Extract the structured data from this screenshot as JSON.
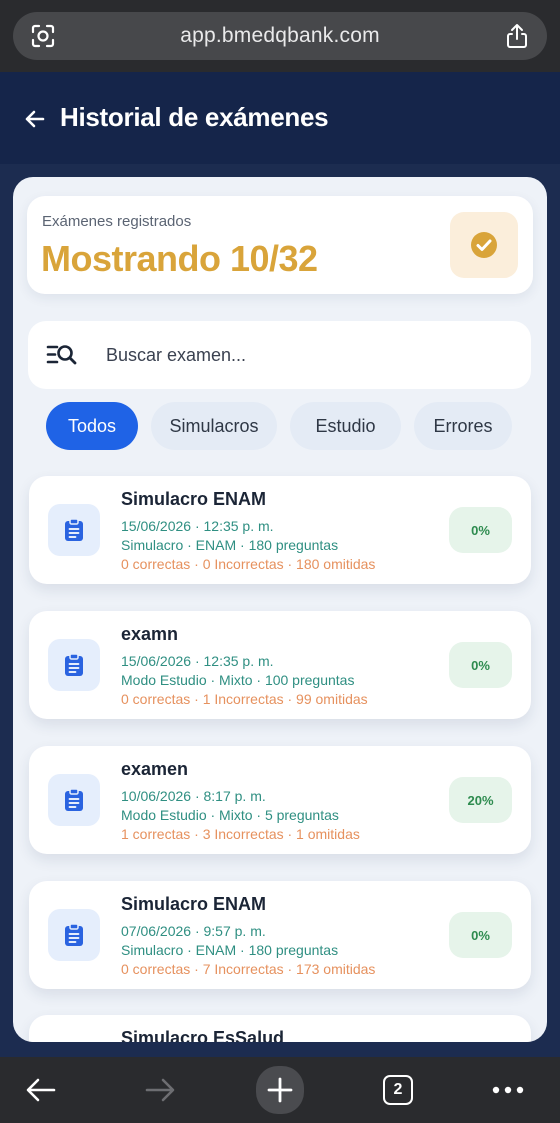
{
  "browser": {
    "url": "app.bmedqbank.com",
    "tab_count": "2"
  },
  "header": {
    "title": "Historial de exámenes"
  },
  "summary": {
    "label": "Exámenes registrados",
    "value": "Mostrando 10/32"
  },
  "search": {
    "placeholder": "Buscar examen..."
  },
  "filters": [
    {
      "label": "Todos",
      "active": true
    },
    {
      "label": "Simulacros",
      "active": false
    },
    {
      "label": "Estudio",
      "active": false
    },
    {
      "label": "Errores",
      "active": false
    }
  ],
  "exams": [
    {
      "title": "Simulacro ENAM",
      "date": "15/06/2026 · 12:35 p. m.",
      "meta": "Simulacro · ENAM · 180 preguntas",
      "stats": "0 correctas · 0 Incorrectas · 180 omitidas",
      "score": "0%"
    },
    {
      "title": "examn",
      "date": "15/06/2026 · 12:35 p. m.",
      "meta": "Modo Estudio · Mixto · 100 preguntas",
      "stats": "0 correctas · 1 Incorrectas · 99 omitidas",
      "score": "0%"
    },
    {
      "title": "examen",
      "date": "10/06/2026 · 8:17 p. m.",
      "meta": "Modo Estudio · Mixto · 5 preguntas",
      "stats": "1 correctas · 3 Incorrectas · 1 omitidas",
      "score": "20%"
    },
    {
      "title": "Simulacro ENAM",
      "date": "07/06/2026 · 9:57 p. m.",
      "meta": "Simulacro · ENAM · 180 preguntas",
      "stats": "0 correctas · 7 Incorrectas · 173 omitidas",
      "score": "0%"
    },
    {
      "title": "Simulacro EsSalud"
    }
  ],
  "icons": {
    "back": "arrow-left-icon",
    "badge": "check-circle-icon",
    "search": "search-list-icon",
    "exam": "clipboard-icon"
  },
  "colors": {
    "accent": "#1f63e6",
    "summary_value": "#d9a43a",
    "meta_text": "#2f8f82",
    "stats_text": "#e6915e",
    "score_text": "#2e8b4f"
  }
}
